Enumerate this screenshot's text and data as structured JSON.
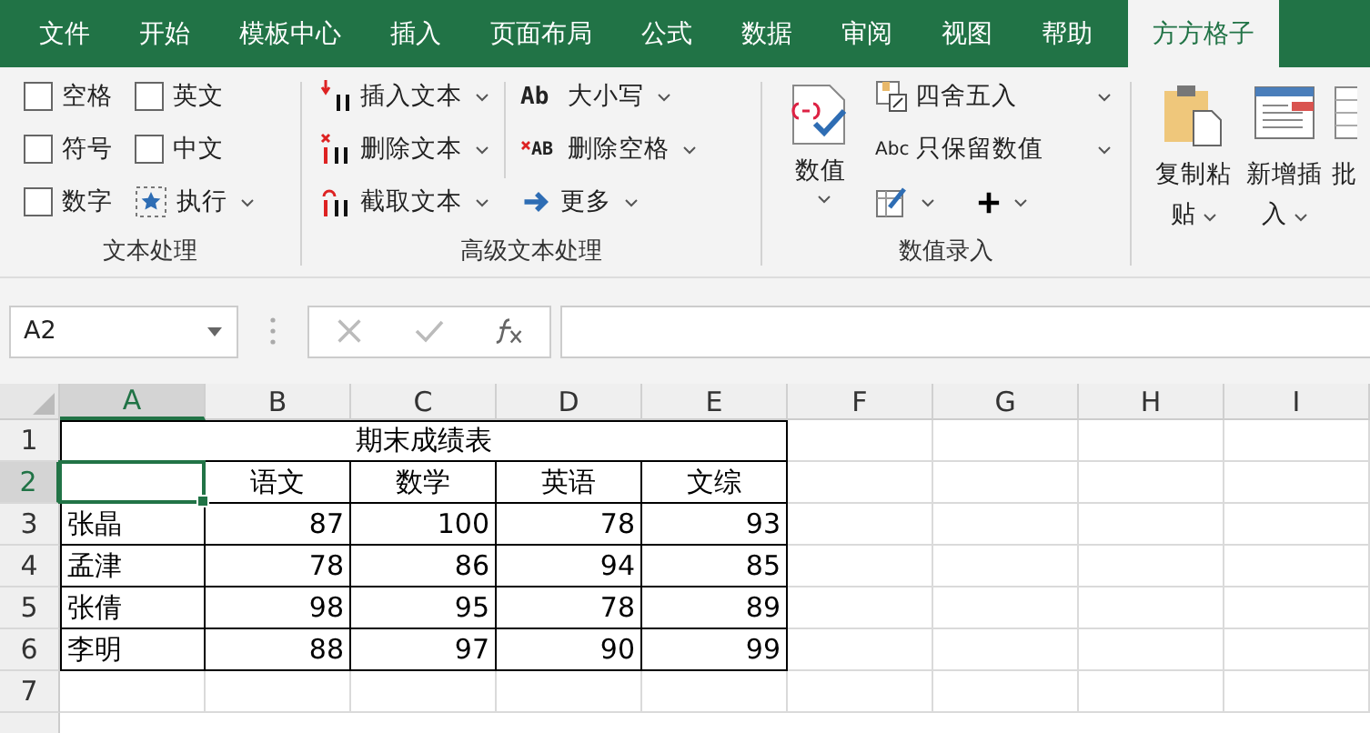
{
  "tabs": [
    {
      "label": "文件",
      "selected": false
    },
    {
      "label": "开始",
      "selected": false
    },
    {
      "label": "模板中心",
      "selected": false
    },
    {
      "label": "插入",
      "selected": false
    },
    {
      "label": "页面布局",
      "selected": false
    },
    {
      "label": "公式",
      "selected": false
    },
    {
      "label": "数据",
      "selected": false
    },
    {
      "label": "审阅",
      "selected": false
    },
    {
      "label": "视图",
      "selected": false
    },
    {
      "label": "帮助",
      "selected": false
    },
    {
      "label": "方方格子",
      "selected": true
    }
  ],
  "ribbon": {
    "text_group": {
      "label": "文本处理",
      "checkboxes": [
        {
          "label": "空格",
          "checked": false
        },
        {
          "label": "符号",
          "checked": false
        },
        {
          "label": "数字",
          "checked": false
        },
        {
          "label": "英文",
          "checked": false
        },
        {
          "label": "中文",
          "checked": false
        }
      ],
      "execute": {
        "label": "执行"
      }
    },
    "advanced_group": {
      "label": "高级文本处理",
      "commands": [
        {
          "label": "插入文本"
        },
        {
          "label": "删除文本"
        },
        {
          "label": "截取文本"
        }
      ],
      "commands_2": [
        {
          "label": "大小写",
          "icon_text": "Ab"
        },
        {
          "label": "删除空格",
          "icon_text": "AB"
        },
        {
          "label": "更多"
        }
      ]
    },
    "number_group": {
      "label": "数值录入",
      "big_button": {
        "label": "数值"
      },
      "commands": [
        {
          "label": "四舍五入"
        },
        {
          "label": "只保留数值",
          "icon_text": "Abc"
        }
      ]
    },
    "paste_group": {
      "big_buttons": [
        {
          "label": "复制粘贴"
        },
        {
          "label": "新增插入"
        },
        {
          "label": "批"
        }
      ]
    }
  },
  "formula_bar": {
    "name_box": "A2"
  },
  "columns": [
    {
      "label": "A",
      "selected": true
    },
    {
      "label": "B",
      "selected": false
    },
    {
      "label": "C",
      "selected": false
    },
    {
      "label": "D",
      "selected": false
    },
    {
      "label": "E",
      "selected": false
    },
    {
      "label": "F",
      "selected": false
    },
    {
      "label": "G",
      "selected": false
    },
    {
      "label": "H",
      "selected": false
    },
    {
      "label": "I",
      "selected": false
    }
  ],
  "row_numbers": [
    {
      "label": "1",
      "selected": false
    },
    {
      "label": "2",
      "selected": true
    },
    {
      "label": "3",
      "selected": false
    },
    {
      "label": "4",
      "selected": false
    },
    {
      "label": "5",
      "selected": false
    },
    {
      "label": "6",
      "selected": false
    },
    {
      "label": "7",
      "selected": false
    }
  ],
  "table": {
    "title": "期末成绩表",
    "header": [
      "语文",
      "数学",
      "英语",
      "文综"
    ],
    "rows": [
      {
        "name": "张晶",
        "scores": [
          "87",
          "100",
          "78",
          "93"
        ]
      },
      {
        "name": "孟津",
        "scores": [
          "78",
          "86",
          "94",
          "85"
        ]
      },
      {
        "name": "张倩",
        "scores": [
          "98",
          "95",
          "78",
          "89"
        ]
      },
      {
        "name": "李明",
        "scores": [
          "88",
          "97",
          "90",
          "99"
        ]
      }
    ]
  }
}
